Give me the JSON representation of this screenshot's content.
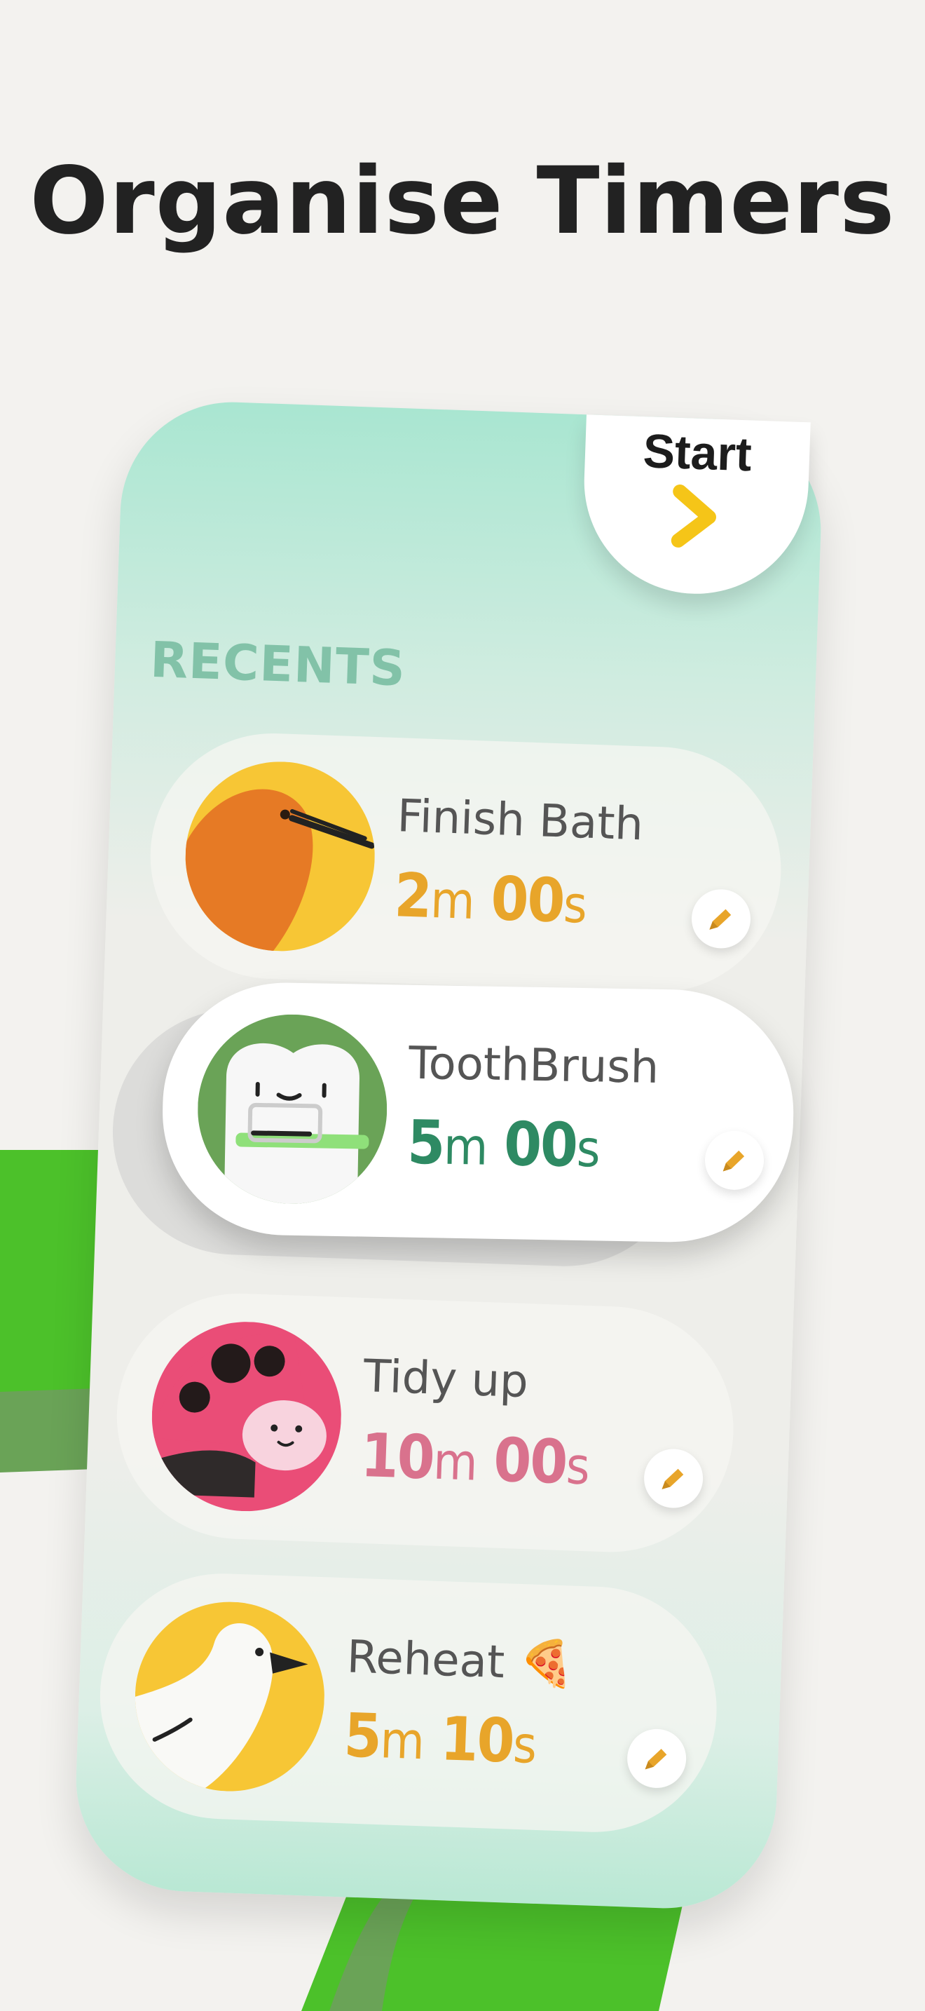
{
  "headline": "Organise Timers",
  "start_button": {
    "label": "Start",
    "icon": "chevron-right-icon"
  },
  "section_title": "RECENTS",
  "colors": {
    "orange_accent": "#e8a52a",
    "green_accent": "#2e8a63",
    "pink_accent": "#d9728d",
    "section_title": "#82c2a8",
    "bg_arc": "#4cc12a"
  },
  "timers": [
    {
      "name": "Finish Bath",
      "minutes": "2",
      "minutes_unit": "m",
      "seconds": "00",
      "seconds_unit": "s",
      "avatar": "kiwi-bird-icon",
      "edit_icon": "pencil-icon"
    },
    {
      "name": "ToothBrush",
      "minutes": "5",
      "minutes_unit": "m",
      "seconds": "00",
      "seconds_unit": "s",
      "avatar": "tooth-icon",
      "edit_icon": "pencil-icon"
    },
    {
      "name": "Tidy up",
      "minutes": "10",
      "minutes_unit": "m",
      "seconds": "00",
      "seconds_unit": "s",
      "avatar": "ladybug-icon",
      "edit_icon": "pencil-icon"
    },
    {
      "name": "Reheat 🍕",
      "minutes": "5",
      "minutes_unit": "m",
      "seconds": "10",
      "seconds_unit": "s",
      "avatar": "seagull-icon",
      "edit_icon": "pencil-icon"
    }
  ]
}
